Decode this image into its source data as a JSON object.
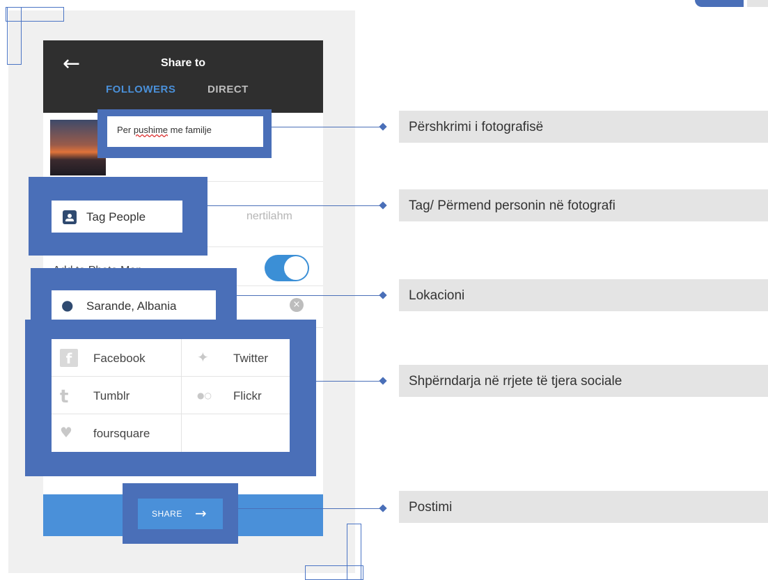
{
  "header": {
    "back_icon": "arrow-left-icon",
    "title": "Share to",
    "tab_followers": "FOLLOWERS",
    "tab_direct": "DIRECT"
  },
  "caption": {
    "word1": "Per",
    "word2": "pushime",
    "word3": "me familje"
  },
  "tag_people": {
    "label": "Tag People",
    "icon": "person-badge-icon",
    "tagged_user": "nertilahm"
  },
  "photo_map": {
    "label": "Add to Photo Map",
    "toggle_on": true
  },
  "location": {
    "label": "Sarande, Albania",
    "icon": "map-pin-icon",
    "clear_icon": "clear-x-icon"
  },
  "social": [
    {
      "label": "Facebook",
      "icon": "facebook-icon"
    },
    {
      "label": "Twitter",
      "icon": "twitter-icon"
    },
    {
      "label": "Tumblr",
      "icon": "tumblr-icon"
    },
    {
      "label": "Flickr",
      "icon": "flickr-icon"
    },
    {
      "label": "foursquare",
      "icon": "foursquare-icon"
    }
  ],
  "share_button": {
    "label": "SHARE",
    "icon": "arrow-right-icon"
  },
  "callouts": [
    "Përshkrimi i fotografisë",
    "Tag/ Përmend personin në fotografi",
    "Lokacioni",
    "Shpërndarja në rrjete të tjera sociale",
    "Postimi"
  ],
  "colors": {
    "highlight": "#4a6fb8",
    "header_bg": "#2f2f2f",
    "accent": "#4a90d9",
    "callout_bg": "#e4e4e4"
  }
}
